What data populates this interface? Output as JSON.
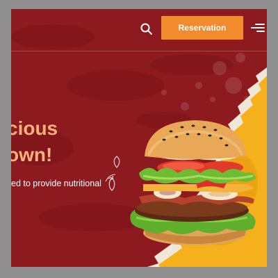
{
  "header": {
    "search_icon": "search-icon",
    "reservation_label": "Reservation",
    "menu_icon": "hamburger-menu-icon"
  },
  "hero": {
    "headline_line1": "cious",
    "headline_line2": "own!",
    "subtext": "ed to provide nutritional"
  },
  "colors": {
    "background": "#8c1a1f",
    "accent": "#f28a2e",
    "headline": "#f6b17c",
    "yellow_panel": "#f5b01c"
  }
}
